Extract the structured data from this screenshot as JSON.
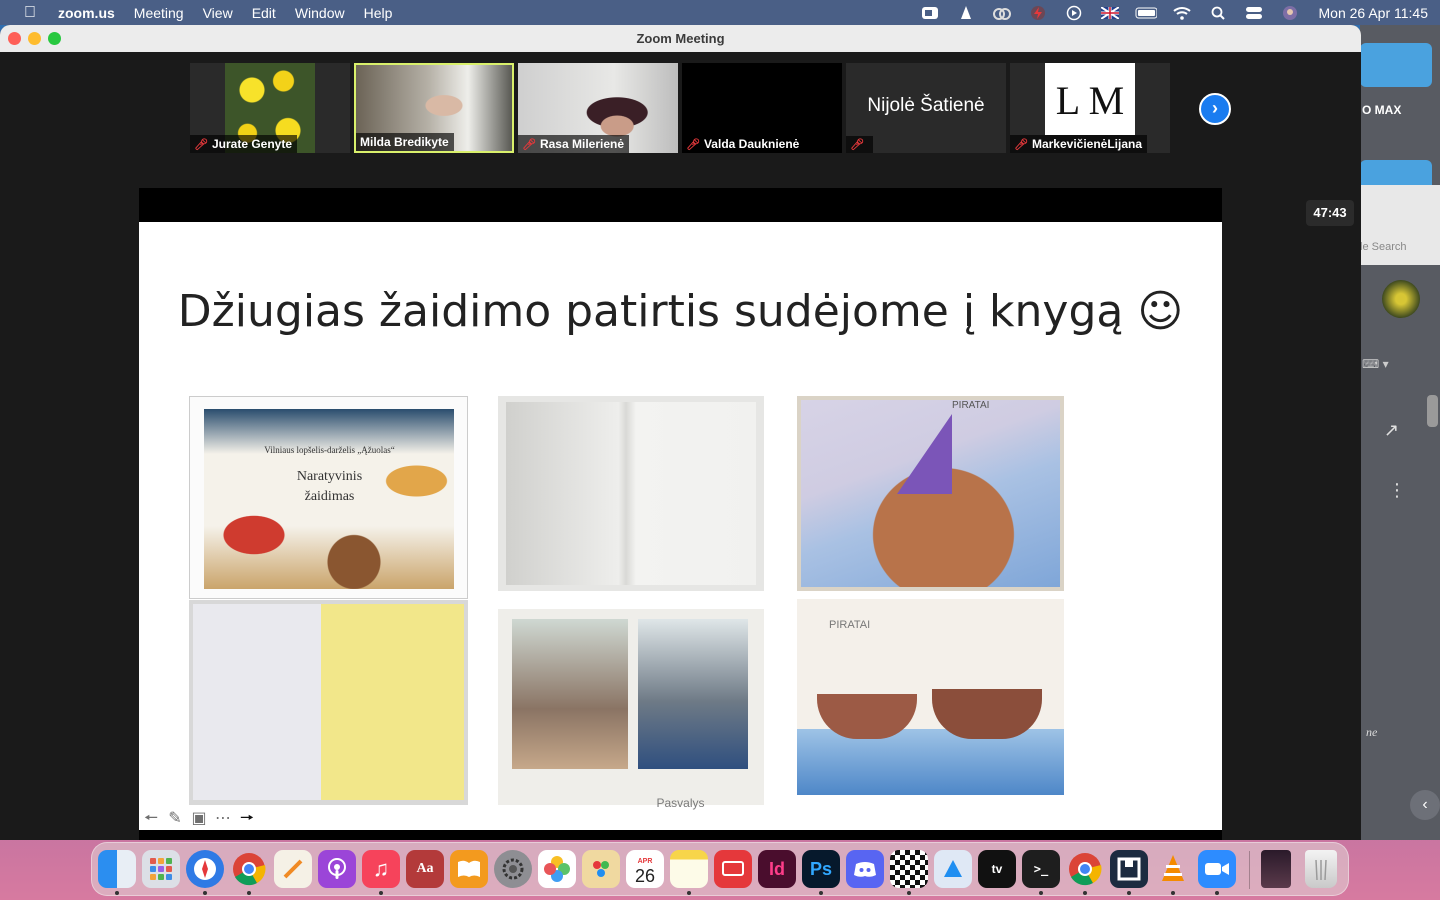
{
  "menubar": {
    "app": "zoom.us",
    "menus": [
      "Meeting",
      "View",
      "Edit",
      "Window",
      "Help"
    ],
    "clock": "Mon 26 Apr  11:45"
  },
  "window": {
    "title": "Zoom Meeting"
  },
  "participants": [
    {
      "name": "Jurate Genyte",
      "muted": true
    },
    {
      "name": "Milda Bredikyte",
      "muted": false,
      "active": true
    },
    {
      "name": "Rasa Milerienė",
      "muted": true
    },
    {
      "name": "Valda Dauknienė",
      "muted": true
    },
    {
      "name": "",
      "display_name": "Nijolė Šatienė",
      "muted": true
    },
    {
      "name": "MarkevičienėLijana",
      "avatar_text": "L M",
      "muted": true
    }
  ],
  "timer": "47:43",
  "slide": {
    "title": "Džiugias žaidimo patirtis sudėjome į knygą ☺",
    "photo1_caption_school": "Vilniaus lopšelis-darželis „Ąžuolas“",
    "photo1_caption_title_1": "Naratyvinis",
    "photo1_caption_title_2": "žaidimas",
    "photo3_label": "PIRATAI",
    "photo6_label": "PIRATAI",
    "footer": "Pasvalys"
  },
  "background_window": {
    "label": "O MAX",
    "search_placeholder": "le Search",
    "italic_text": "ne"
  },
  "accent_colors": {
    "active_speaker_border": "#d9f06b",
    "next_button": "#1a7cf0",
    "muted_mic": "#e5383b"
  },
  "dock": {
    "calendar_month": "APR",
    "calendar_day": "26",
    "apps": [
      "finder-icon",
      "launchpad-icon",
      "safari-icon",
      "chrome-icon",
      "pages-icon",
      "podcasts-icon",
      "music-icon",
      "dictionary-icon",
      "books-icon",
      "system-preferences-icon",
      "photos-icon",
      "colour-picker-icon",
      "calendar-icon",
      "notes-icon",
      "screen-mirror-icon",
      "indesign-icon",
      "photoshop-icon",
      "discord-icon",
      "chess-icon",
      "keynote-icon",
      "apple-tv-icon",
      "terminal-icon",
      "chrome-icon-2",
      "screenflick-icon",
      "vlc-icon",
      "zoom-icon",
      "portrait-icon",
      "trash-icon"
    ],
    "labels": {
      "indesign": "Id",
      "photoshop": "Ps",
      "dictionary": "Aa",
      "tv": "tv"
    }
  }
}
